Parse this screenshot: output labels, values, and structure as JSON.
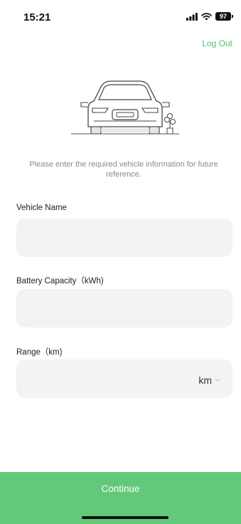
{
  "status_bar": {
    "time": "15:21",
    "battery": "97"
  },
  "header": {
    "logout_label": "Log Out"
  },
  "intro_text": "Please enter the required vehicle information for future reference.",
  "form": {
    "vehicle_name": {
      "label": "Vehicle Name",
      "value": "",
      "placeholder": ""
    },
    "battery_capacity": {
      "label": "Battery Capacity（kWh)",
      "value": "",
      "placeholder": ""
    },
    "range": {
      "label": "Range（km)",
      "value": "",
      "placeholder": "",
      "unit": "km"
    }
  },
  "footer": {
    "continue_label": "Continue"
  },
  "colors": {
    "accent": "#4cc26c",
    "button_bg": "#62c978",
    "input_bg": "#f3f3f3"
  }
}
